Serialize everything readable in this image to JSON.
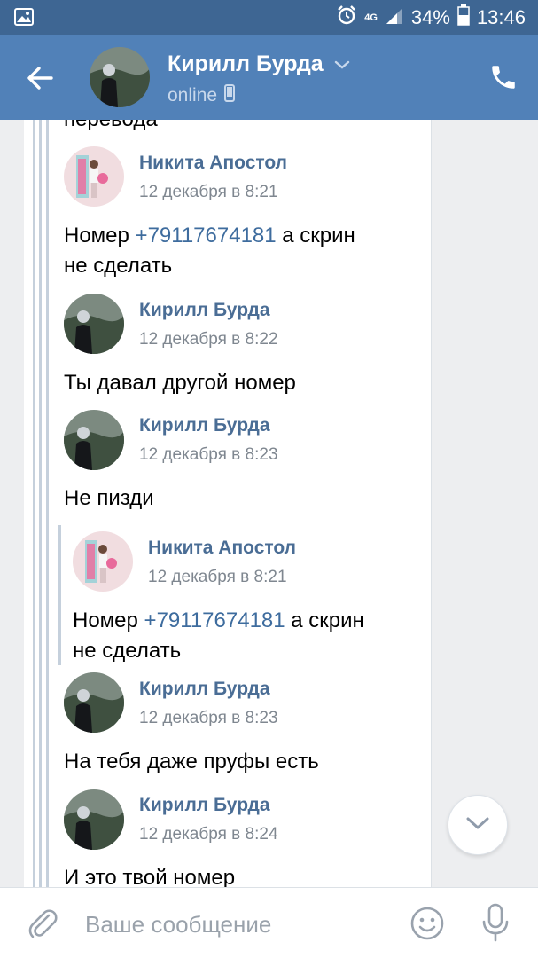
{
  "status_bar": {
    "network": "4G",
    "battery": "34%",
    "time": "13:46"
  },
  "header": {
    "name": "Кирилл Бурда",
    "status": "online"
  },
  "messages": {
    "partial_top": "перевода",
    "m1": {
      "author": "Никита Апостол",
      "time": "12 декабря в 8:21",
      "text_before": "Номер ",
      "phone": "+79117674181",
      "text_after": " а скрин",
      "line2": "не сделать"
    },
    "m2": {
      "author": "Кирилл Бурда",
      "time": "12 декабря в 8:22",
      "text": "Ты давал другой номер"
    },
    "m3": {
      "author": "Кирилл Бурда",
      "time": "12 декабря в 8:23",
      "text": "Не пизди"
    },
    "m4": {
      "author": "Никита Апостол",
      "time": "12 декабря в 8:21",
      "text_before": "Номер ",
      "phone": "+79117674181",
      "text_after": " а скрин",
      "line2": "не сделать"
    },
    "m5": {
      "author": "Кирилл Бурда",
      "time": "12 декабря в 8:23",
      "text": "На тебя даже пруфы есть"
    },
    "m6": {
      "author": "Кирилл Бурда",
      "time": "12 декабря в 8:24",
      "text": "И это твой номер"
    }
  },
  "composer": {
    "placeholder": "Ваше сообщение"
  },
  "colors": {
    "status_bar": "#3e6693",
    "header": "#5181b8",
    "author": "#4a6d95",
    "link": "#3e6c9e"
  },
  "icons": [
    "image-icon",
    "alarm-icon",
    "signal-icon",
    "battery-icon",
    "back-arrow-icon",
    "chevron-down-icon",
    "phone-icon",
    "mobile-icon",
    "scroll-down-icon",
    "attach-icon",
    "emoji-icon",
    "mic-icon"
  ]
}
